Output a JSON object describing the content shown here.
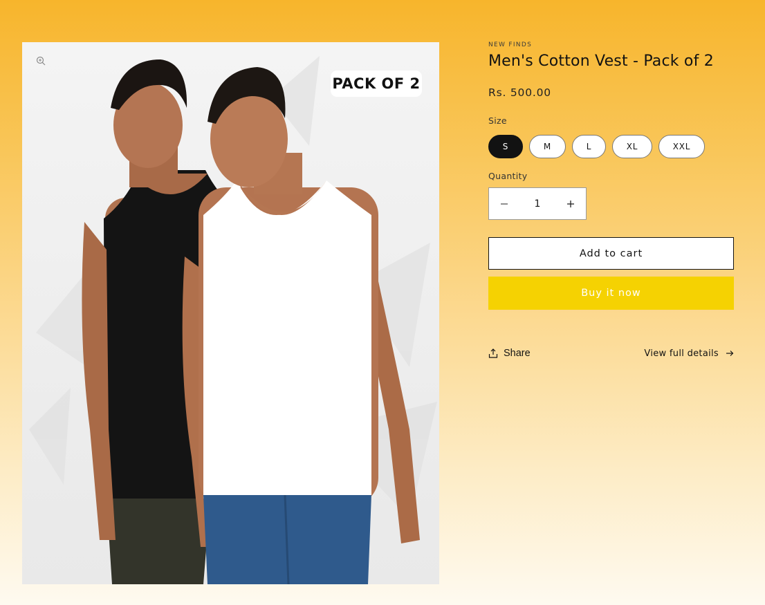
{
  "product": {
    "vendor": "NEW FINDS",
    "title": "Men's Cotton Vest - Pack of 2",
    "price": "Rs. 500.00",
    "image_badge": "PACK OF 2"
  },
  "size": {
    "label": "Size",
    "options": [
      "S",
      "M",
      "L",
      "XL",
      "XXL"
    ],
    "selected": "S"
  },
  "quantity": {
    "label": "Quantity",
    "value": "1"
  },
  "actions": {
    "add_to_cart": "Add to cart",
    "buy_now": "Buy it now",
    "share": "Share",
    "view_details": "View full details"
  },
  "colors": {
    "accent_buy": "#f5d202",
    "selected_pill": "#121212",
    "background_top": "#f7b52c",
    "background_bottom": "#fefaf0"
  },
  "icons": [
    "zoom-icon",
    "minus-icon",
    "plus-icon",
    "share-icon",
    "arrow-right-icon"
  ]
}
